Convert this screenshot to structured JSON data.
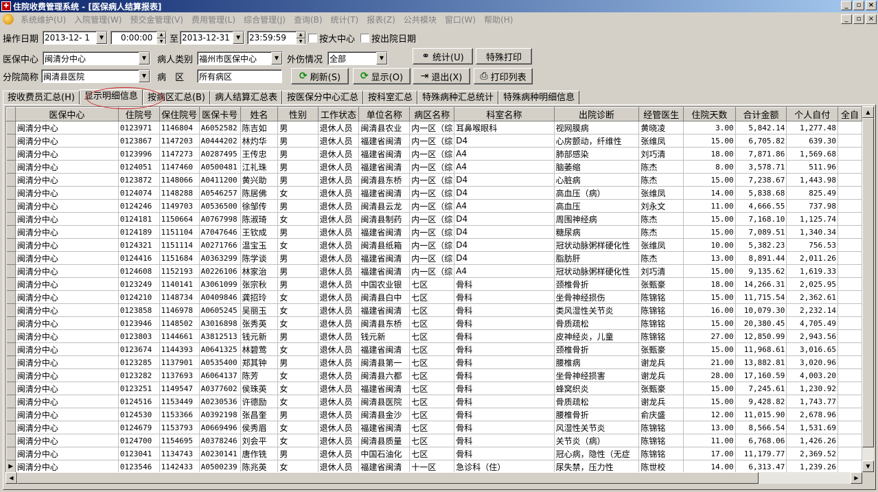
{
  "window": {
    "title": "住院收费管理系统 - [医保病人结算报表]",
    "app_icon": "hospital-app-icon",
    "minimize": "_",
    "maximize": "▫",
    "close": "×"
  },
  "menu": [
    "系统维护(U)",
    "入院管理(W)",
    "预交金管理(V)",
    "费用管理(L)",
    "综合管理(J)",
    "查询(B)",
    "统计(T)",
    "报表(Z)",
    "公共模块",
    "窗口(W)",
    "帮助(H)"
  ],
  "filters": {
    "op_date_label": "操作日期",
    "date_from": "2013-12- 1",
    "time_from": "0:00:00",
    "to_label": "至",
    "date_to": "2013-12-31",
    "time_to": "23:59:59",
    "by_center_label": "按大中心",
    "by_discharge_label": "按出院日期",
    "center_label": "医保中心",
    "center_value": "闽清分中心",
    "patient_type_label": "病人类别",
    "patient_type_value": "福州市医保中心",
    "injury_label": "外伤情况",
    "injury_value": "全部",
    "branch_label": "分院简称",
    "branch_value": "闽清县医院",
    "ward_label": "病　区",
    "ward_value": "所有病区"
  },
  "buttons": {
    "stats": "统计(U)",
    "special_print": "特殊打印",
    "refresh": "刷新(S)",
    "show": "显示(O)",
    "exit": "退出(X)",
    "print_list": "打印列表"
  },
  "tabs": [
    "按收费员汇总(H)",
    "显示明细信息",
    "按病区汇总(B)",
    "病人结算汇总表",
    "按医保分中心汇总",
    "按科室汇总",
    "特殊病种汇总统计",
    "特殊病种明细信息"
  ],
  "active_tab": 1,
  "table": {
    "columns": [
      "医保中心",
      "住院号",
      "保住院号",
      "医保卡号",
      "姓名",
      "性别",
      "工作状态",
      "单位名称",
      "病区名称",
      "科室名称",
      "出院诊断",
      "经管医生",
      "住院天数",
      "合计金额",
      "个人自付",
      "全自"
    ],
    "rows": [
      [
        "闽清分中心",
        "0123971",
        "1146804",
        "A6052582",
        "陈吉如",
        "男",
        "退休人员",
        "闽清县农业",
        "内一区（综",
        "耳鼻喉眼科",
        "视网膜病",
        "黄晓凌",
        "3.00",
        "5,842.14",
        "1,277.48",
        ""
      ],
      [
        "闽清分中心",
        "0123867",
        "1147203",
        "A0444202",
        "林灼华",
        "男",
        "退休人员",
        "福建省闽清",
        "内一区（综",
        "D4",
        "心房颤动，纤维性",
        "张维凤",
        "15.00",
        "6,705.82",
        "639.30",
        ""
      ],
      [
        "闽清分中心",
        "0123996",
        "1147273",
        "A0287495",
        "王传忠",
        "男",
        "退休人员",
        "福建省闽清",
        "内一区（综",
        "A4",
        "肺部感染",
        "刘巧清",
        "18.00",
        "7,871.86",
        "1,569.68",
        ""
      ],
      [
        "闽清分中心",
        "0124051",
        "1147460",
        "A0500481",
        "江礼珠",
        "男",
        "退休人员",
        "福建省闽清",
        "内一区（综",
        "A4",
        "脑萎缩",
        "陈杰",
        "8.00",
        "3,578.71",
        "511.96",
        ""
      ],
      [
        "闽清分中心",
        "0123872",
        "1148066",
        "A0411200",
        "黄兴助",
        "男",
        "退休人员",
        "闽清县东桥",
        "内一区（综",
        "D4",
        "心脏病",
        "陈杰",
        "15.00",
        "7,238.67",
        "1,443.98",
        ""
      ],
      [
        "闽清分中心",
        "0124074",
        "1148288",
        "A0546257",
        "陈居佛",
        "女",
        "退休人员",
        "福建省闽清",
        "内一区（综",
        "D4",
        "高血压（病）",
        "张维凤",
        "14.00",
        "5,838.68",
        "825.49",
        ""
      ],
      [
        "闽清分中心",
        "0124246",
        "1149703",
        "A0536500",
        "徐邹传",
        "男",
        "退休人员",
        "闽清县云龙",
        "内一区（综",
        "A4",
        "高血压",
        "刘永文",
        "11.00",
        "4,666.55",
        "737.98",
        ""
      ],
      [
        "闽清分中心",
        "0124181",
        "1150664",
        "A0767998",
        "陈淑琦",
        "女",
        "退休人员",
        "闽清县制药",
        "内一区（综",
        "D4",
        "周围神经病",
        "陈杰",
        "15.00",
        "7,168.10",
        "1,125.74",
        ""
      ],
      [
        "闽清分中心",
        "0124189",
        "1151104",
        "A7047646",
        "王钦成",
        "男",
        "退休人员",
        "福建省闽清",
        "内一区（综",
        "D4",
        "糖尿病",
        "陈杰",
        "15.00",
        "7,089.51",
        "1,340.34",
        ""
      ],
      [
        "闽清分中心",
        "0124321",
        "1151114",
        "A0271766",
        "温宝玉",
        "女",
        "退休人员",
        "闽清县纸箱",
        "内一区（综",
        "D4",
        "冠状动脉粥样硬化性",
        "张维凤",
        "10.00",
        "5,382.23",
        "756.53",
        ""
      ],
      [
        "闽清分中心",
        "0124416",
        "1151684",
        "A0363299",
        "陈学谈",
        "男",
        "退休人员",
        "福建省闽清",
        "内一区（综",
        "D4",
        "脂肪肝",
        "陈杰",
        "13.00",
        "8,891.44",
        "2,011.26",
        ""
      ],
      [
        "闽清分中心",
        "0124608",
        "1152193",
        "A0226106",
        "林家治",
        "男",
        "退休人员",
        "福建省闽清",
        "内一区（综",
        "A4",
        "冠状动脉粥样硬化性",
        "刘巧清",
        "15.00",
        "9,135.62",
        "1,619.33",
        ""
      ],
      [
        "闽清分中心",
        "0123249",
        "1140141",
        "A3061099",
        "张宗秋",
        "男",
        "退休人员",
        "中国农业银",
        "七区",
        "骨科",
        "颈椎骨折",
        "张甄豪",
        "18.00",
        "14,266.31",
        "2,025.95",
        ""
      ],
      [
        "闽清分中心",
        "0124210",
        "1148734",
        "A0409846",
        "龚招玲",
        "女",
        "退休人员",
        "闽清县白中",
        "七区",
        "骨科",
        "坐骨神经损伤",
        "陈锦铭",
        "15.00",
        "11,715.54",
        "2,362.61",
        ""
      ],
      [
        "闽清分中心",
        "0123858",
        "1146978",
        "A0605245",
        "吴丽玉",
        "女",
        "退休人员",
        "福建省闽清",
        "七区",
        "骨科",
        "类风湿性关节炎",
        "陈锦铭",
        "16.00",
        "10,079.30",
        "2,232.14",
        ""
      ],
      [
        "闽清分中心",
        "0123946",
        "1148502",
        "A3016898",
        "张秀英",
        "女",
        "退休人员",
        "闽清县东桥",
        "七区",
        "骨科",
        "骨质疏松",
        "陈锦铭",
        "15.00",
        "20,380.45",
        "4,705.49",
        ""
      ],
      [
        "闽清分中心",
        "0123803",
        "1144661",
        "A3812513",
        "钱元新",
        "男",
        "退休人员",
        "钱元新",
        "七区",
        "骨科",
        "皮神经炎，儿童",
        "陈锦铭",
        "27.00",
        "12,850.99",
        "2,943.56",
        ""
      ],
      [
        "闽清分中心",
        "0123674",
        "1144393",
        "A0641325",
        "林碧莺",
        "女",
        "退休人员",
        "福建省闽清",
        "七区",
        "骨科",
        "颈椎骨折",
        "张甄豪",
        "15.00",
        "11,968.61",
        "3,016.65",
        ""
      ],
      [
        "闽清分中心",
        "0123285",
        "1137901",
        "A0535400",
        "郑其钟",
        "男",
        "退休人员",
        "闽清县第一",
        "七区",
        "骨科",
        "腰椎病",
        "谢龙兵",
        "21.00",
        "13,882.81",
        "3,020.96",
        ""
      ],
      [
        "闽清分中心",
        "0123282",
        "1137693",
        "A6064137",
        "陈芳",
        "女",
        "退休人员",
        "闽清县六都",
        "七区",
        "骨科",
        "坐骨神经损害",
        "谢龙兵",
        "28.00",
        "17,160.59",
        "4,003.20",
        ""
      ],
      [
        "闽清分中心",
        "0123251",
        "1149547",
        "A0377602",
        "侯珠英",
        "女",
        "退休人员",
        "福建省闽清",
        "七区",
        "骨科",
        "蜂窝织炎",
        "张甄豪",
        "15.00",
        "7,245.61",
        "1,230.92",
        ""
      ],
      [
        "闽清分中心",
        "0124516",
        "1153449",
        "A0230536",
        "许德励",
        "女",
        "退休人员",
        "闽清县医院",
        "七区",
        "骨科",
        "骨质疏松",
        "谢龙兵",
        "15.00",
        "9,428.82",
        "1,743.77",
        ""
      ],
      [
        "闽清分中心",
        "0124530",
        "1153366",
        "A0392198",
        "张昌奎",
        "男",
        "退休人员",
        "闽清县金沙",
        "七区",
        "骨科",
        "腰椎骨折",
        "俞庆盛",
        "12.00",
        "11,015.90",
        "2,678.96",
        ""
      ],
      [
        "闽清分中心",
        "0124679",
        "1153793",
        "A0669496",
        "侯秀眉",
        "女",
        "退休人员",
        "福建省闽清",
        "七区",
        "骨科",
        "风湿性关节炎",
        "陈锦铭",
        "13.00",
        "8,566.54",
        "1,531.69",
        ""
      ],
      [
        "闽清分中心",
        "0124700",
        "1154695",
        "A0378246",
        "刘会平",
        "女",
        "退休人员",
        "闽清县质量",
        "七区",
        "骨科",
        "关节炎（病）",
        "陈锦铭",
        "11.00",
        "6,768.06",
        "1,426.26",
        ""
      ],
      [
        "闽清分中心",
        "0123041",
        "1134743",
        "A0230141",
        "唐作铣",
        "男",
        "退休人员",
        "中国石油化",
        "七区",
        "骨科",
        "冠心病，隐性（无症",
        "陈锦铭",
        "17.00",
        "11,179.77",
        "2,369.52",
        ""
      ],
      [
        "闽清分中心",
        "0123546",
        "1142433",
        "A0500239",
        "陈兆英",
        "女",
        "退休人员",
        "福建省闽清",
        "十一区",
        "急诊科（住）",
        "尿失禁，压力性",
        "陈世校",
        "14.00",
        "6,313.47",
        "1,239.26",
        ""
      ]
    ],
    "current_row_marker": "▶"
  }
}
